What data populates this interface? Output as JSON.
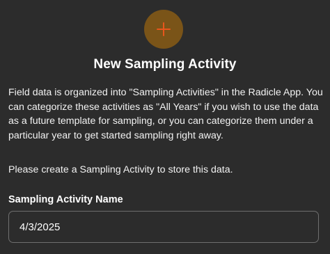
{
  "header": {
    "icon": "plus-icon",
    "icon_bg_color": "#7a5418",
    "icon_color": "#e8561c",
    "title": "New Sampling Activity"
  },
  "body": {
    "description": "Field data is organized into \"Sampling Activities\" in the Radicle App. You can categorize these activities as \"All Years\" if you wish to use the data as a future template for sampling, or you can categorize them under a particular year to get started sampling right away.",
    "prompt": "Please create a Sampling Activity to store this data."
  },
  "form": {
    "name_label": "Sampling Activity Name",
    "name_value": "4/3/2025"
  }
}
